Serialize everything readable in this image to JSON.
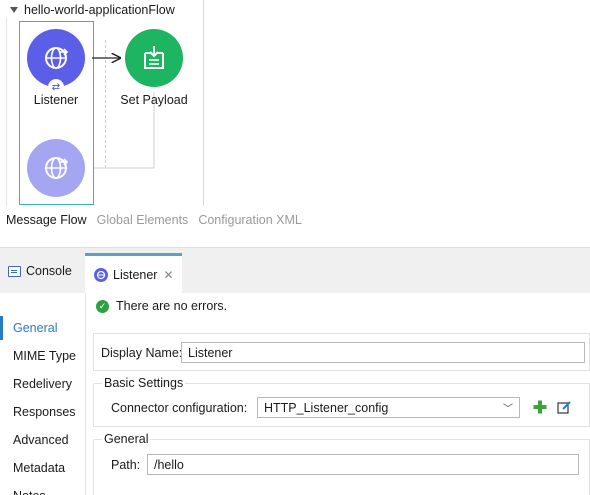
{
  "flow": {
    "title": "hello-world-applicationFlow",
    "nodes": {
      "listener_label": "Listener",
      "set_payload_label": "Set Payload"
    }
  },
  "editor_tabs": [
    "Message Flow",
    "Global Elements",
    "Configuration XML"
  ],
  "panel_tabs": {
    "console": "Console",
    "listener": "Listener"
  },
  "sidebar": {
    "items": [
      {
        "label": "General",
        "active": true
      },
      {
        "label": "MIME Type"
      },
      {
        "label": "Redelivery"
      },
      {
        "label": "Responses"
      },
      {
        "label": "Advanced"
      },
      {
        "label": "Metadata"
      },
      {
        "label": "Notes"
      }
    ]
  },
  "status": {
    "text": "There are no errors."
  },
  "form": {
    "display_name_label": "Display Name:",
    "display_name_value": "Listener",
    "basic_settings_title": "Basic Settings",
    "connector_config_label": "Connector configuration:",
    "connector_config_value": "HTTP_Listener_config",
    "general_title": "General",
    "path_label": "Path:",
    "path_value": "/hello"
  },
  "colors": {
    "listener_node": "#5b5fe8",
    "set_payload_node": "#1db562",
    "error_source_node": "#a4a6f2",
    "active_accent": "#2a7ac7",
    "ok_green": "#2ea043"
  },
  "icons": {
    "listener": "globe-arrow-icon",
    "set_payload": "payload-icon",
    "sync": "sync-icon",
    "status": "check-circle-icon",
    "add_config": "plus-icon",
    "edit_config": "edit-icon",
    "console": "console-icon",
    "close": "close-icon"
  }
}
